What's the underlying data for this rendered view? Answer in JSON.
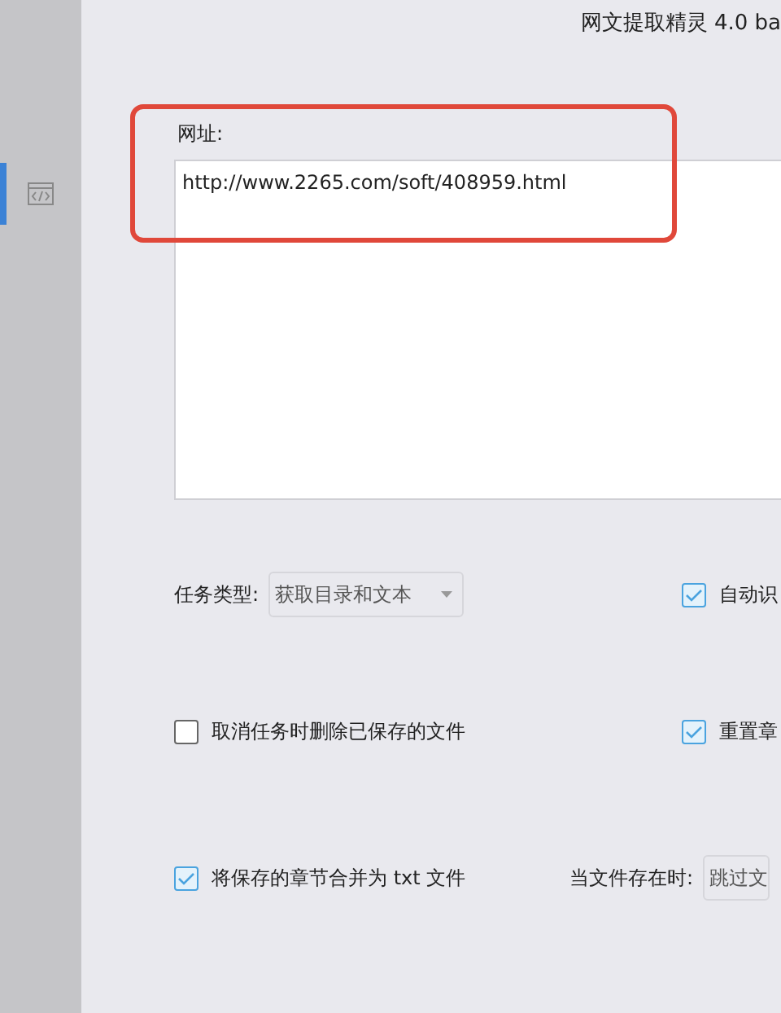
{
  "window": {
    "title": "网文提取精灵 4.0 ba"
  },
  "sidebar": {
    "items": [
      {
        "kind": "code",
        "selected": true
      }
    ]
  },
  "url_field": {
    "label": "网址:",
    "value": "http://www.2265.com/soft/408959.html",
    "highlighted": true
  },
  "task_type": {
    "label": "任务类型:",
    "value": "获取目录和文本"
  },
  "options": [
    {
      "label": "自动识",
      "checked": true
    },
    {
      "label": "取消任务时删除已保存的文件",
      "checked": false
    },
    {
      "label": "重置章",
      "checked": true
    },
    {
      "label": "将保存的章节合并为 txt 文件",
      "checked": true
    }
  ],
  "file_exists": {
    "label": "当文件存在时:",
    "value": "跳过文"
  }
}
